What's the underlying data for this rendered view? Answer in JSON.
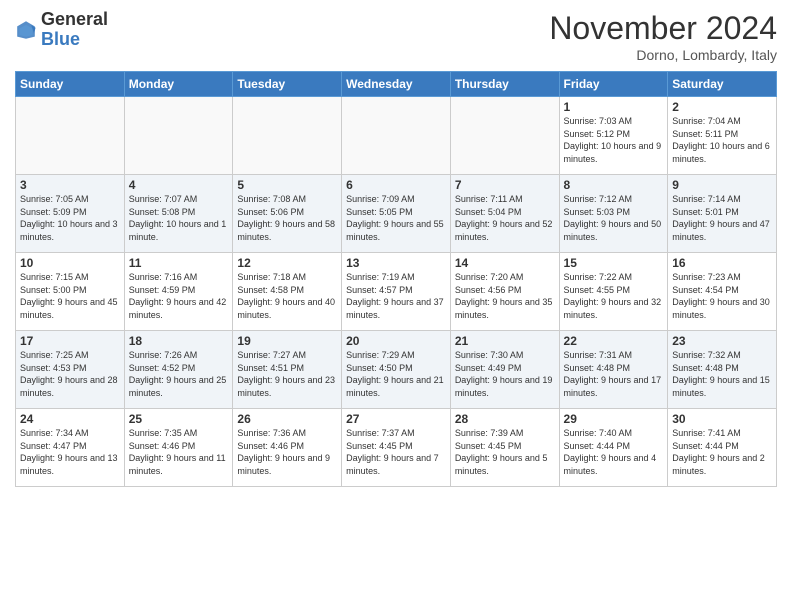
{
  "logo": {
    "general": "General",
    "blue": "Blue"
  },
  "title": "November 2024",
  "subtitle": "Dorno, Lombardy, Italy",
  "days_of_week": [
    "Sunday",
    "Monday",
    "Tuesday",
    "Wednesday",
    "Thursday",
    "Friday",
    "Saturday"
  ],
  "weeks": [
    [
      {
        "day": "",
        "info": ""
      },
      {
        "day": "",
        "info": ""
      },
      {
        "day": "",
        "info": ""
      },
      {
        "day": "",
        "info": ""
      },
      {
        "day": "",
        "info": ""
      },
      {
        "day": "1",
        "info": "Sunrise: 7:03 AM\nSunset: 5:12 PM\nDaylight: 10 hours and 9 minutes."
      },
      {
        "day": "2",
        "info": "Sunrise: 7:04 AM\nSunset: 5:11 PM\nDaylight: 10 hours and 6 minutes."
      }
    ],
    [
      {
        "day": "3",
        "info": "Sunrise: 7:05 AM\nSunset: 5:09 PM\nDaylight: 10 hours and 3 minutes."
      },
      {
        "day": "4",
        "info": "Sunrise: 7:07 AM\nSunset: 5:08 PM\nDaylight: 10 hours and 1 minute."
      },
      {
        "day": "5",
        "info": "Sunrise: 7:08 AM\nSunset: 5:06 PM\nDaylight: 9 hours and 58 minutes."
      },
      {
        "day": "6",
        "info": "Sunrise: 7:09 AM\nSunset: 5:05 PM\nDaylight: 9 hours and 55 minutes."
      },
      {
        "day": "7",
        "info": "Sunrise: 7:11 AM\nSunset: 5:04 PM\nDaylight: 9 hours and 52 minutes."
      },
      {
        "day": "8",
        "info": "Sunrise: 7:12 AM\nSunset: 5:03 PM\nDaylight: 9 hours and 50 minutes."
      },
      {
        "day": "9",
        "info": "Sunrise: 7:14 AM\nSunset: 5:01 PM\nDaylight: 9 hours and 47 minutes."
      }
    ],
    [
      {
        "day": "10",
        "info": "Sunrise: 7:15 AM\nSunset: 5:00 PM\nDaylight: 9 hours and 45 minutes."
      },
      {
        "day": "11",
        "info": "Sunrise: 7:16 AM\nSunset: 4:59 PM\nDaylight: 9 hours and 42 minutes."
      },
      {
        "day": "12",
        "info": "Sunrise: 7:18 AM\nSunset: 4:58 PM\nDaylight: 9 hours and 40 minutes."
      },
      {
        "day": "13",
        "info": "Sunrise: 7:19 AM\nSunset: 4:57 PM\nDaylight: 9 hours and 37 minutes."
      },
      {
        "day": "14",
        "info": "Sunrise: 7:20 AM\nSunset: 4:56 PM\nDaylight: 9 hours and 35 minutes."
      },
      {
        "day": "15",
        "info": "Sunrise: 7:22 AM\nSunset: 4:55 PM\nDaylight: 9 hours and 32 minutes."
      },
      {
        "day": "16",
        "info": "Sunrise: 7:23 AM\nSunset: 4:54 PM\nDaylight: 9 hours and 30 minutes."
      }
    ],
    [
      {
        "day": "17",
        "info": "Sunrise: 7:25 AM\nSunset: 4:53 PM\nDaylight: 9 hours and 28 minutes."
      },
      {
        "day": "18",
        "info": "Sunrise: 7:26 AM\nSunset: 4:52 PM\nDaylight: 9 hours and 25 minutes."
      },
      {
        "day": "19",
        "info": "Sunrise: 7:27 AM\nSunset: 4:51 PM\nDaylight: 9 hours and 23 minutes."
      },
      {
        "day": "20",
        "info": "Sunrise: 7:29 AM\nSunset: 4:50 PM\nDaylight: 9 hours and 21 minutes."
      },
      {
        "day": "21",
        "info": "Sunrise: 7:30 AM\nSunset: 4:49 PM\nDaylight: 9 hours and 19 minutes."
      },
      {
        "day": "22",
        "info": "Sunrise: 7:31 AM\nSunset: 4:48 PM\nDaylight: 9 hours and 17 minutes."
      },
      {
        "day": "23",
        "info": "Sunrise: 7:32 AM\nSunset: 4:48 PM\nDaylight: 9 hours and 15 minutes."
      }
    ],
    [
      {
        "day": "24",
        "info": "Sunrise: 7:34 AM\nSunset: 4:47 PM\nDaylight: 9 hours and 13 minutes."
      },
      {
        "day": "25",
        "info": "Sunrise: 7:35 AM\nSunset: 4:46 PM\nDaylight: 9 hours and 11 minutes."
      },
      {
        "day": "26",
        "info": "Sunrise: 7:36 AM\nSunset: 4:46 PM\nDaylight: 9 hours and 9 minutes."
      },
      {
        "day": "27",
        "info": "Sunrise: 7:37 AM\nSunset: 4:45 PM\nDaylight: 9 hours and 7 minutes."
      },
      {
        "day": "28",
        "info": "Sunrise: 7:39 AM\nSunset: 4:45 PM\nDaylight: 9 hours and 5 minutes."
      },
      {
        "day": "29",
        "info": "Sunrise: 7:40 AM\nSunset: 4:44 PM\nDaylight: 9 hours and 4 minutes."
      },
      {
        "day": "30",
        "info": "Sunrise: 7:41 AM\nSunset: 4:44 PM\nDaylight: 9 hours and 2 minutes."
      }
    ]
  ]
}
